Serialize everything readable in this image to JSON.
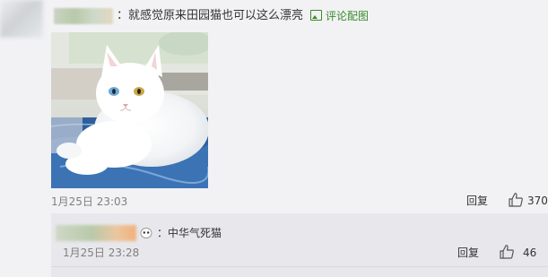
{
  "comment": {
    "text": "：就感觉原来田园猫也可以这么漂亮",
    "photo_link_label": "评论配图",
    "time": "1月25日 23:03",
    "reply_label": "回复",
    "like_count": "370"
  },
  "reply": {
    "text": "：中华气死猫",
    "time": "1月25日 23:28",
    "reply_label": "回复",
    "like_count": "46"
  },
  "colors": {
    "background": "#f2f2f5",
    "link": "#3a8b2b",
    "meta": "#808080"
  },
  "icons": {
    "photo_link": "image-icon",
    "like": "thumbs-up-icon"
  }
}
